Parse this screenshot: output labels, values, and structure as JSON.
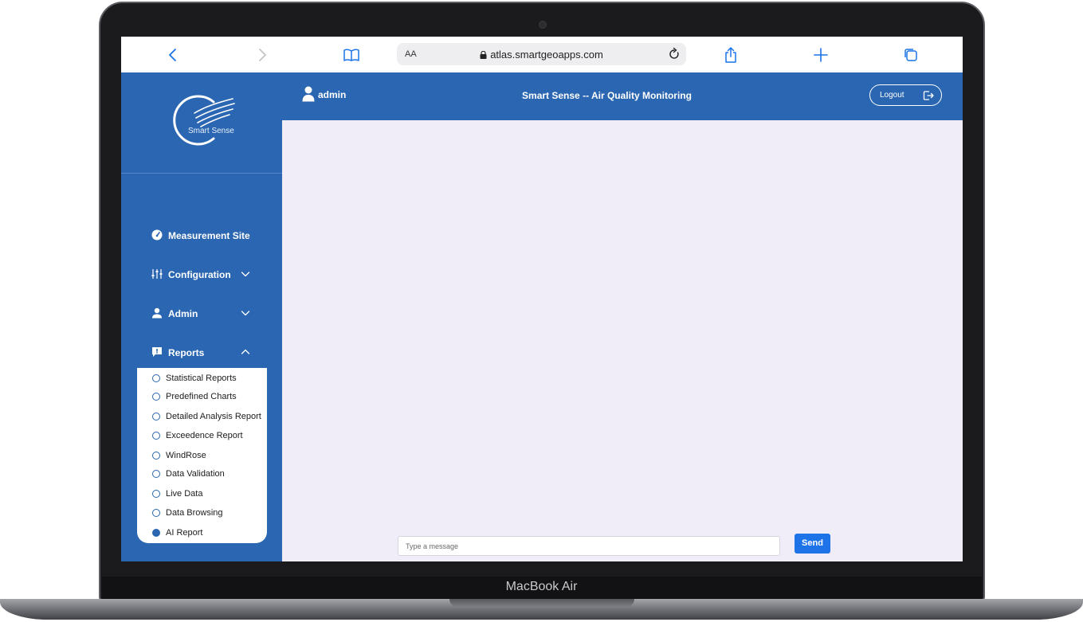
{
  "device": {
    "label": "MacBook Air"
  },
  "browser": {
    "aa_label": "AA",
    "url": "atlas.smartgeoapps.com",
    "icons": [
      "back-icon",
      "forward-icon",
      "bookmarks-icon",
      "lock-icon",
      "reload-icon",
      "share-icon",
      "new-tab-icon",
      "tabs-icon"
    ]
  },
  "app": {
    "logo_text": "Smart Sense",
    "title": "Smart Sense -- Air Quality Monitoring",
    "user": "admin",
    "logout_label": "Logout",
    "brand_color": "#2a66b1"
  },
  "sidebar": {
    "items": [
      {
        "label": "Measurement Site",
        "icon": "dashboard-icon"
      },
      {
        "label": "Configuration",
        "icon": "sliders-icon",
        "expanded": false
      },
      {
        "label": "Admin",
        "icon": "user-icon",
        "expanded": false
      },
      {
        "label": "Reports",
        "icon": "report-icon",
        "expanded": true
      }
    ],
    "reports_submenu": [
      {
        "label": "Statistical Reports",
        "active": false
      },
      {
        "label": "Predefined Charts",
        "active": false
      },
      {
        "label": "Detailed Analysis Report",
        "active": false
      },
      {
        "label": "Exceedence Report",
        "active": false
      },
      {
        "label": "WindRose",
        "active": false
      },
      {
        "label": "Data Validation",
        "active": false
      },
      {
        "label": "Live Data",
        "active": false
      },
      {
        "label": "Data Browsing",
        "active": false
      },
      {
        "label": "AI Report",
        "active": true
      }
    ]
  },
  "chat": {
    "placeholder": "Type a message",
    "value": "",
    "send_label": "Send"
  }
}
